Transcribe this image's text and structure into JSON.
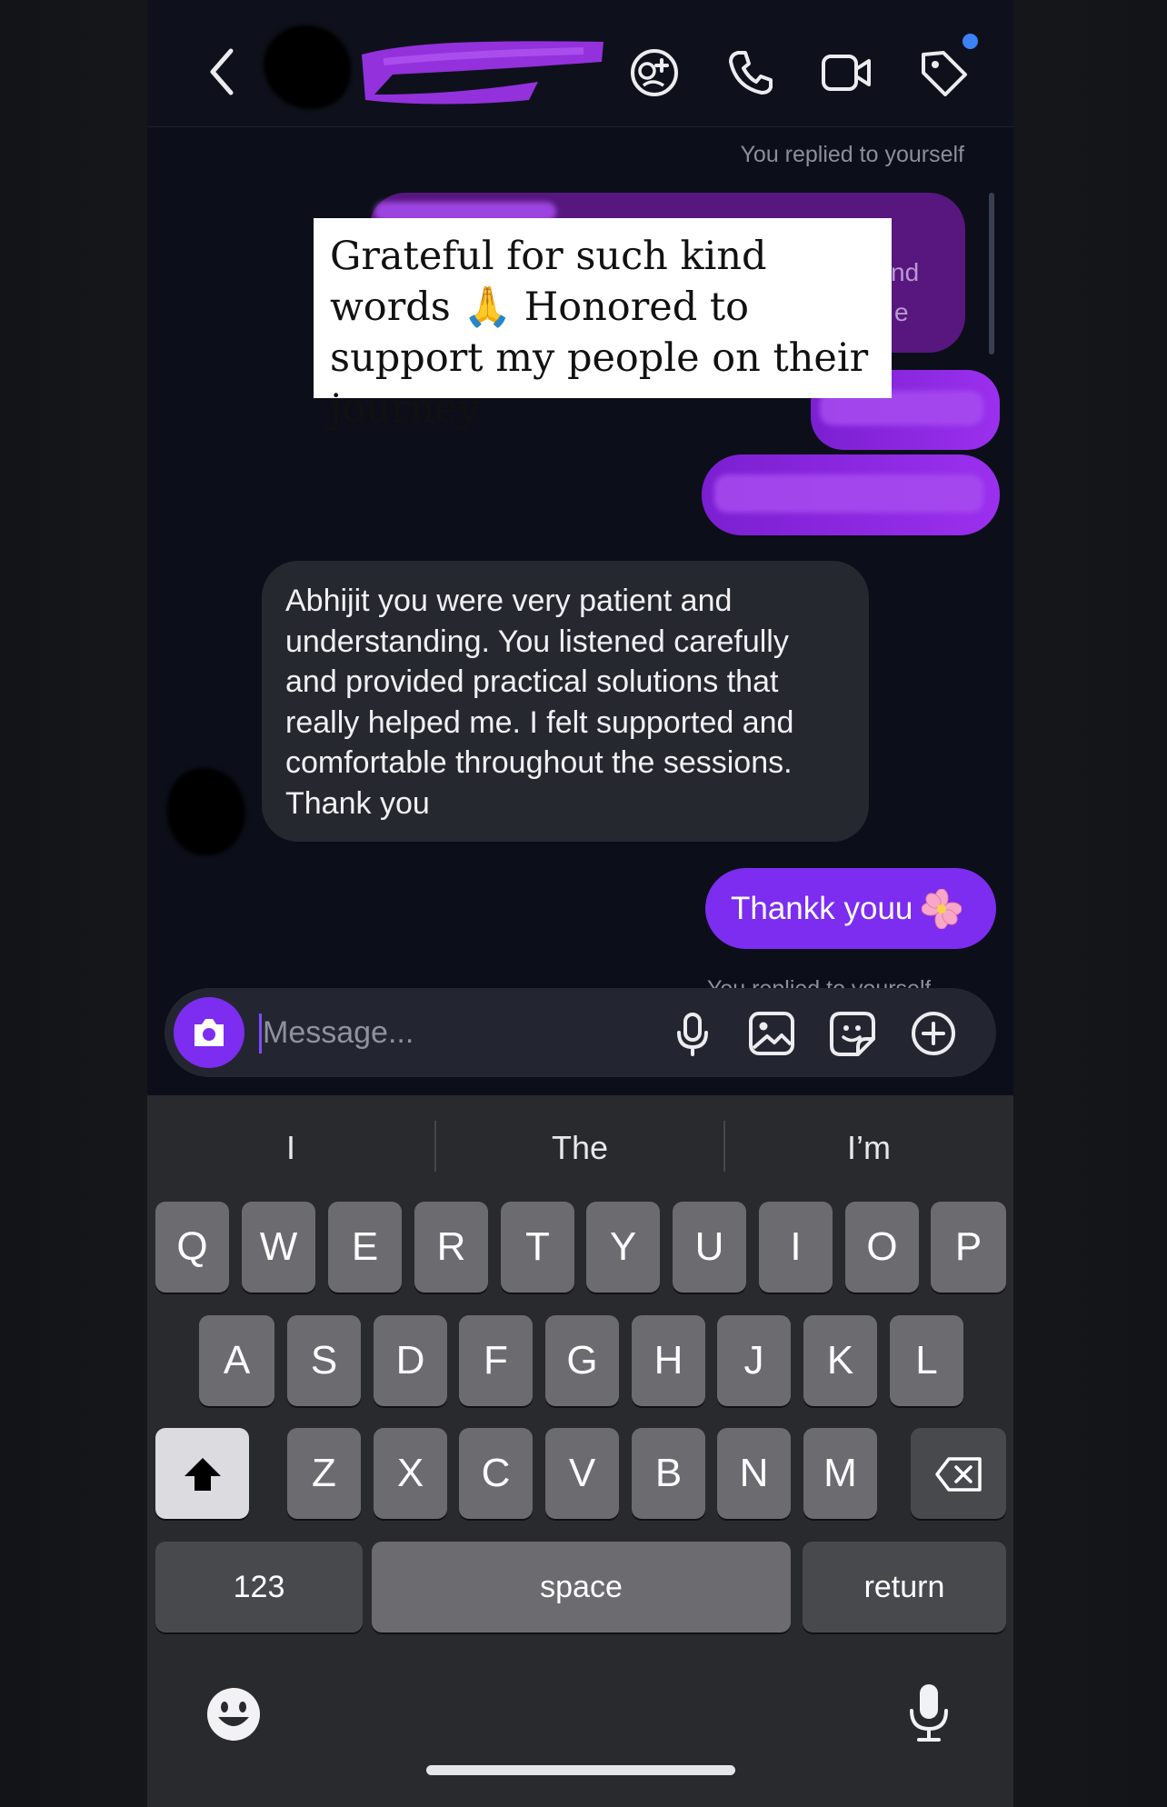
{
  "header": {
    "back_icon": "chevron-left-icon",
    "actions": [
      "sparkle-icon",
      "phone-icon",
      "video-icon",
      "tag-icon"
    ],
    "notification_color": "#3b82f6"
  },
  "chat": {
    "replied_note": "You replied to yourself",
    "caption": "Grateful for such kind words 🙏 Honored to support my people on their journey",
    "caption_hidden_fragments": [
      "nd",
      "e"
    ],
    "received_message": "Abhijit you were very patient and understanding. You listened carefully and provided practical solutions that really helped me. I felt supported and comfortable throughout the sessions. Thank you",
    "sent_message": "Thankk youu",
    "sent_emoji": "flower-icon",
    "peek_note": "You replied to yourself",
    "accent_color": "#7c2df0"
  },
  "composer": {
    "placeholder": "Message...",
    "icons": [
      "camera-icon",
      "microphone-icon",
      "gallery-icon",
      "sticker-icon",
      "add-icon"
    ]
  },
  "keyboard": {
    "suggestions": [
      "I",
      "The",
      "I’m"
    ],
    "row1": [
      "Q",
      "W",
      "E",
      "R",
      "T",
      "Y",
      "U",
      "I",
      "O",
      "P"
    ],
    "row2": [
      "A",
      "S",
      "D",
      "F",
      "G",
      "H",
      "J",
      "K",
      "L"
    ],
    "row3": [
      "Z",
      "X",
      "C",
      "V",
      "B",
      "N",
      "M"
    ],
    "numbers_label": "123",
    "space_label": "space",
    "return_label": "return",
    "bottom_icons": [
      "emoji-icon",
      "dictation-icon"
    ]
  }
}
